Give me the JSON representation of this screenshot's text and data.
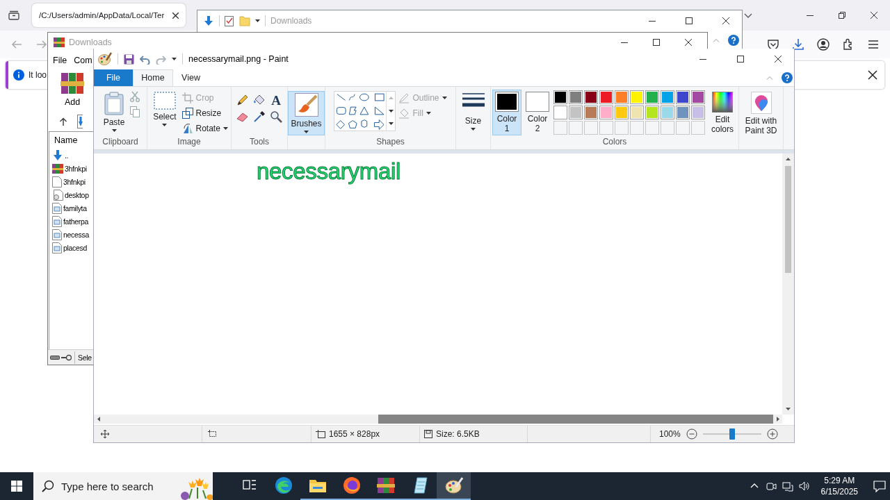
{
  "browser": {
    "tab_title": "/C:/Users/admin/AppData/Local/Ter",
    "notification": "It loo"
  },
  "explorer": {
    "title": "Downloads"
  },
  "winrar": {
    "title": "Downloads",
    "menu": [
      "File",
      "Com"
    ],
    "add": "Add",
    "column": "Name",
    "files": [
      {
        "name": "..",
        "kind": "up"
      },
      {
        "name": "3hfnkpi",
        "kind": "archive"
      },
      {
        "name": "3hfnkpi",
        "kind": "blank"
      },
      {
        "name": "desktop",
        "kind": "settings"
      },
      {
        "name": "familyta",
        "kind": "image"
      },
      {
        "name": "fatherpa",
        "kind": "image"
      },
      {
        "name": "necessa",
        "kind": "image"
      },
      {
        "name": "placesd",
        "kind": "image"
      }
    ],
    "status": "Sele"
  },
  "paint": {
    "title": "necessarymail.png - Paint",
    "tabs": [
      {
        "label": "File",
        "kind": "menu",
        "selected": false
      },
      {
        "label": "Home",
        "kind": "tab",
        "selected": true
      },
      {
        "label": "View",
        "kind": "tab",
        "selected": false
      }
    ],
    "clipboard": {
      "paste": "Paste",
      "label": "Clipboard"
    },
    "image": {
      "select": "Select",
      "actions": [
        {
          "label": "Crop",
          "kind": "crop",
          "disabled": true
        },
        {
          "label": "Resize",
          "kind": "resize",
          "disabled": false
        },
        {
          "label": "Rotate",
          "kind": "rotate",
          "disabled": false
        }
      ],
      "label": "Image"
    },
    "tools": {
      "text_tool": "A",
      "label": "Tools"
    },
    "brushes": {
      "label": "Brushes",
      "selected": true
    },
    "shapes": {
      "options": [
        {
          "label": "Outline",
          "kind": "outline",
          "disabled": true
        },
        {
          "label": "Fill",
          "kind": "fill",
          "disabled": true
        }
      ],
      "label": "Shapes"
    },
    "size": {
      "label": "Size"
    },
    "colors": {
      "slots": [
        {
          "label": "Color 1",
          "color": "#000000",
          "selected": true
        },
        {
          "label": "Color 2",
          "color": "#ffffff",
          "selected": false
        }
      ],
      "palette": [
        {
          "color": "#000000"
        },
        {
          "color": "#7f7f7f"
        },
        {
          "color": "#880015"
        },
        {
          "color": "#ed1c24"
        },
        {
          "color": "#ff7f27"
        },
        {
          "color": "#fff200"
        },
        {
          "color": "#22b14c"
        },
        {
          "color": "#00a2e8"
        },
        {
          "color": "#3f48cc"
        },
        {
          "color": "#a349a4"
        },
        {
          "color": "#ffffff"
        },
        {
          "color": "#c3c3c3"
        },
        {
          "color": "#b97a57"
        },
        {
          "color": "#ffaec9"
        },
        {
          "color": "#ffc90e"
        },
        {
          "color": "#efe4b0"
        },
        {
          "color": "#b5e61d"
        },
        {
          "color": "#99d9ea"
        },
        {
          "color": "#7092be"
        },
        {
          "color": "#c8bfe7"
        }
      ],
      "edit": "Edit colors",
      "label": "Colors"
    },
    "paint3d": "Edit with Paint 3D",
    "canvas_text": "necessarymail",
    "status": {
      "dimensions": "1655 × 828px",
      "size": "Size: 6.5KB",
      "zoom": {
        "reading": "100%",
        "level": 0.5
      }
    }
  },
  "taskbar": {
    "search_placeholder": "Type here to search",
    "apps": [
      {
        "kind": "task-view",
        "running": false,
        "selected": false
      },
      {
        "kind": "edge",
        "running": false,
        "selected": false
      },
      {
        "kind": "explorer",
        "running": true,
        "selected": false
      },
      {
        "kind": "firefox",
        "running": true,
        "selected": false
      },
      {
        "kind": "winrar",
        "running": true,
        "selected": false
      },
      {
        "kind": "notepad",
        "running": true,
        "selected": false
      },
      {
        "kind": "paint",
        "running": true,
        "selected": true
      }
    ],
    "time": "5:29 AM",
    "date": "6/15/2025"
  }
}
